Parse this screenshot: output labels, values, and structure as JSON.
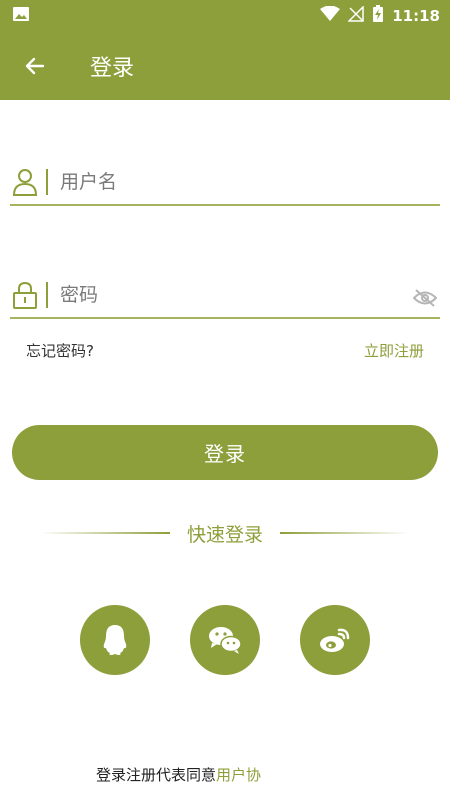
{
  "status_bar": {
    "time": "11:18"
  },
  "header": {
    "title": "登录"
  },
  "username": {
    "placeholder": "用户名"
  },
  "password": {
    "placeholder": "密码"
  },
  "links": {
    "forgot": "忘记密码?",
    "register": "立即注册"
  },
  "login_button": {
    "label": "登录"
  },
  "quick_login": {
    "label": "快速登录"
  },
  "social": [
    "qq",
    "wechat",
    "weibo"
  ],
  "footer": {
    "text": "登录注册代表同意",
    "agreement": "用户协"
  },
  "colors": {
    "accent": "#8d9f3a"
  }
}
